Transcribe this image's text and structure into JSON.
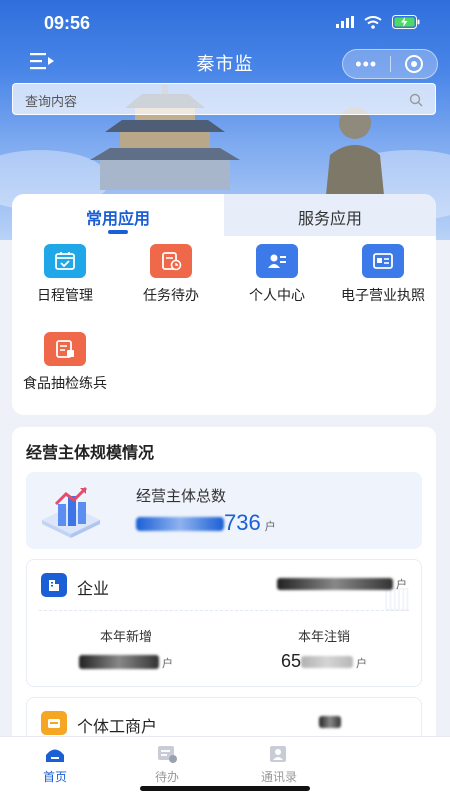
{
  "status_bar": {
    "time": "09:56",
    "icons": [
      "signal-icon",
      "wifi-icon",
      "battery-charging-icon"
    ]
  },
  "nav": {
    "title": "秦市监",
    "menu_icon": "menu-collapse-icon",
    "more_icon": "more-dots-icon",
    "close_icon": "target-icon"
  },
  "search": {
    "placeholder": "查询内容",
    "icon": "search-icon"
  },
  "app_tabs": [
    {
      "label": "常用应用",
      "active": true
    },
    {
      "label": "服务应用",
      "active": false
    }
  ],
  "apps": [
    {
      "label": "日程管理",
      "icon": "calendar-check-icon",
      "color": "#1fa7e8"
    },
    {
      "label": "任务待办",
      "icon": "task-clock-icon",
      "color": "#f0684a"
    },
    {
      "label": "个人中心",
      "icon": "user-card-icon",
      "color": "#3b7ae8"
    },
    {
      "label": "电子营业执照",
      "icon": "license-icon",
      "color": "#3b7ae8"
    },
    {
      "label": "食品抽检练兵",
      "icon": "food-inspection-icon",
      "color": "#f0684a"
    }
  ],
  "scale_section": {
    "title": "经营主体规模情况",
    "total": {
      "label": "经营主体总数",
      "value_visible": "736",
      "unit": "户"
    },
    "enterprise": {
      "label": "企业",
      "icon": "enterprise-icon",
      "color": "#1a5fd6",
      "unit": "户",
      "new_label": "本年新增",
      "new_unit": "户",
      "cancel_label": "本年注销",
      "cancel_value_visible": "65",
      "cancel_unit": "户"
    },
    "individual": {
      "label": "个体工商户",
      "icon": "shop-icon",
      "color": "#f5a623"
    }
  },
  "tabbar": [
    {
      "label": "首页",
      "icon": "home-icon",
      "active": true,
      "color": "#1a5fd6"
    },
    {
      "label": "待办",
      "icon": "todo-icon",
      "active": false,
      "color": "#999999"
    },
    {
      "label": "通讯录",
      "icon": "contacts-icon",
      "active": false,
      "color": "#999999"
    }
  ]
}
